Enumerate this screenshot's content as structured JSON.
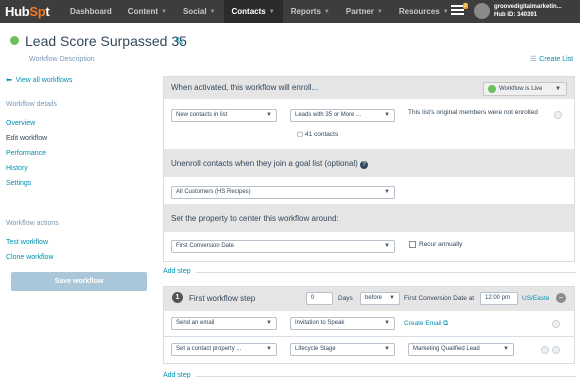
{
  "nav": {
    "logo_a": "Hub",
    "logo_b": "Sp",
    "logo_c": "t",
    "items": [
      "Dashboard",
      "Content",
      "Social",
      "Contacts",
      "Reports",
      "Partner",
      "Resources"
    ],
    "badge": "2",
    "account_name": "groovedigitalmarketin...",
    "hub_id": "Hub ID: 340391"
  },
  "header": {
    "title": "Lead Score Surpassed 35",
    "description": "Workflow Description",
    "create_list": "Create List"
  },
  "sidebar": {
    "view_all": "View all workflows",
    "details_heading": "Workflow details",
    "details": [
      "Overview",
      "Edit workflow",
      "Performance",
      "History",
      "Settings"
    ],
    "actions_heading": "Workflow actions",
    "actions": [
      "Test workflow",
      "Clone workflow"
    ],
    "save": "Save workflow"
  },
  "enroll": {
    "heading": "When activated, this workflow will enroll...",
    "live_label": "Workflow is Live",
    "select1": "New contacts in list",
    "select2": "Leads with 35 or More ...",
    "note": "This list's original members were not enrolled",
    "count": "41 contacts"
  },
  "unenroll": {
    "heading": "Unenroll contacts when they join a goal list (optional)",
    "select": "All Customers (HS Recipes)"
  },
  "center": {
    "heading": "Set the property to center this workflow around:",
    "select": "First Conversion Date",
    "recur": "Recur annually"
  },
  "add_step": "Add step",
  "step1": {
    "num": "1",
    "heading": "First workflow step",
    "days_value": "0",
    "days_label": "Days",
    "relation": "before",
    "anchor": "First Conversion Date at",
    "time": "12:00 pm",
    "tz": "US/Easte",
    "action1": "Send an email",
    "action1_value": "Invitation to Speak",
    "create_email": "Create Email",
    "action2": "Set a contact property ...",
    "action2_prop": "Lifecycle Stage",
    "action2_value": "Marketing Qualified Lead"
  },
  "colors": {
    "nav": "#3d3d3d",
    "accent": "#f57722",
    "link": "#0091ae",
    "live": "#6cc15b"
  }
}
